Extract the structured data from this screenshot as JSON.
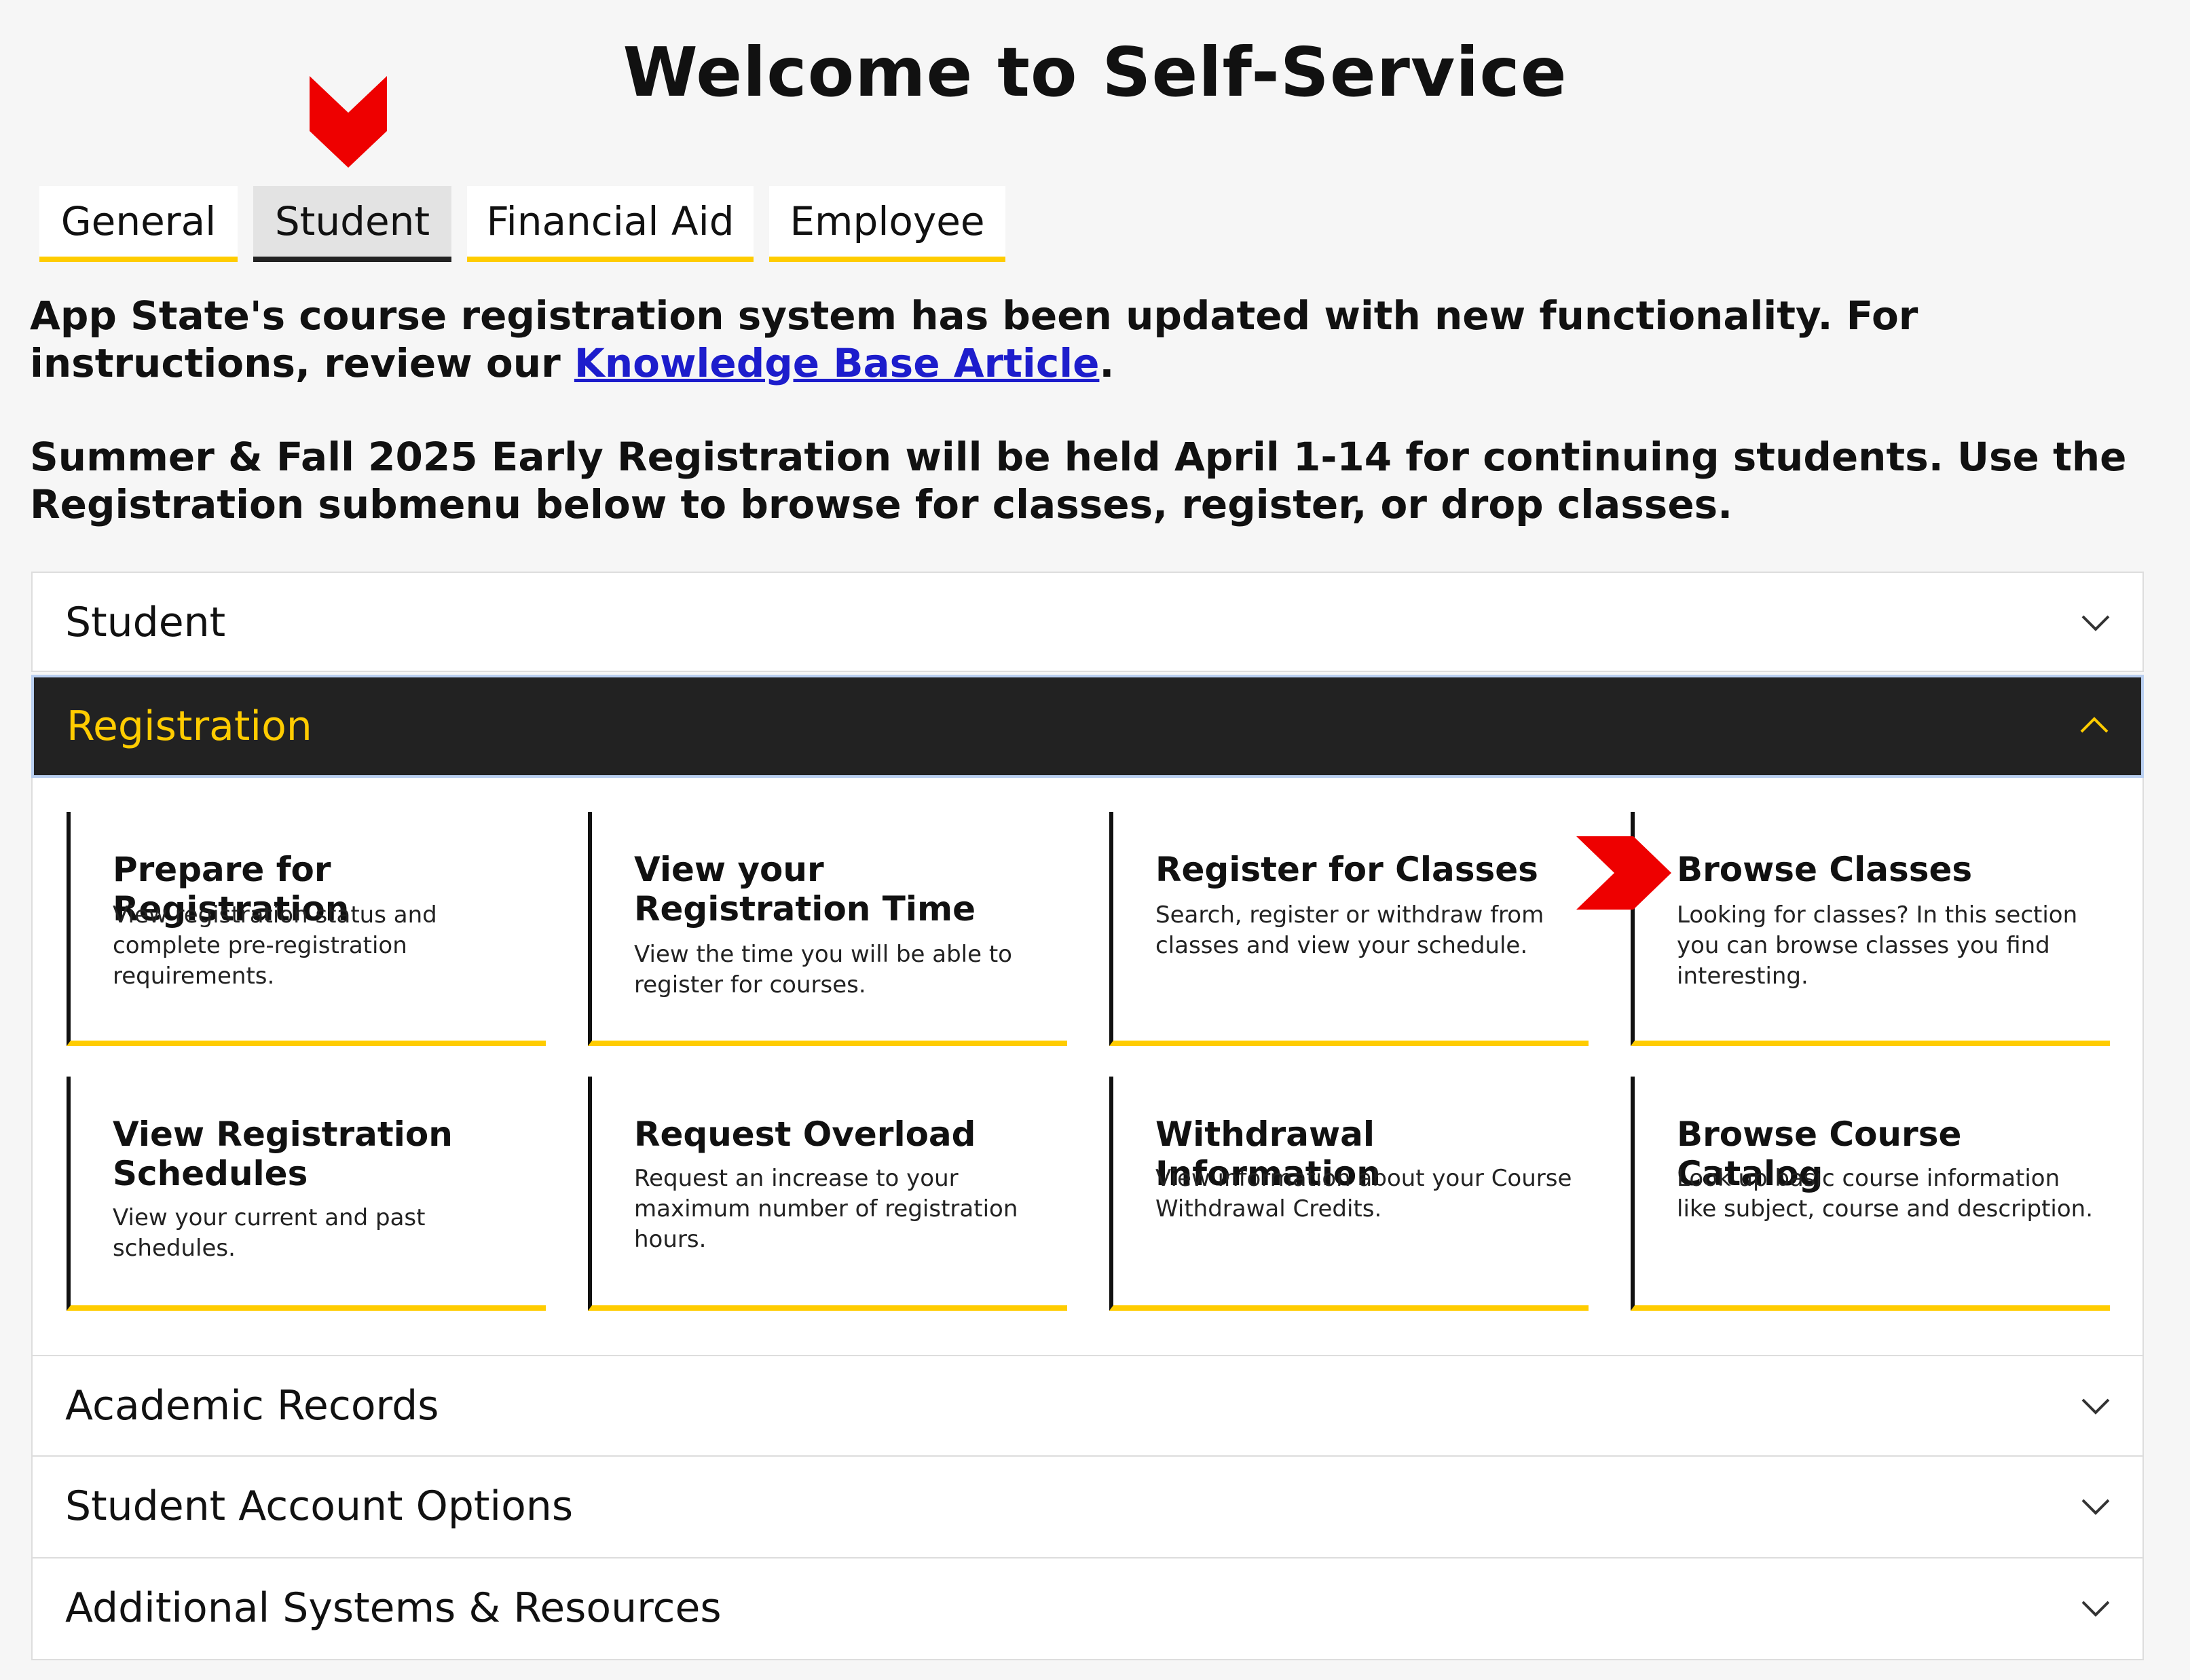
{
  "page": {
    "title": "Welcome to Self-Service"
  },
  "tabs": [
    {
      "label": "General"
    },
    {
      "label": "Student"
    },
    {
      "label": "Financial Aid"
    },
    {
      "label": "Employee"
    }
  ],
  "active_tab": "Student",
  "intro": {
    "line1_text": "App State's course registration system has been updated with new functionality. For instructions, review our",
    "link_text": "Knowledge Base Article",
    "link_suffix": ".",
    "line2_text": "Summer & Fall 2025 Early Registration will be held April 1-14 for continuing students. Use the Registration submenu below to browse for classes, register, or drop classes."
  },
  "accordion": {
    "student": {
      "label": "Student",
      "expanded": false
    },
    "registration": {
      "label": "Registration",
      "expanded": true
    },
    "academic_records": {
      "label": "Academic Records",
      "expanded": false
    },
    "student_account": {
      "label": "Student Account Options",
      "expanded": false
    },
    "additional": {
      "label": "Additional Systems & Resources",
      "expanded": false
    }
  },
  "cards": [
    {
      "title": "Prepare for Registration",
      "desc": "View registration status and complete pre-registration requirements."
    },
    {
      "title": "View your Registration Time",
      "desc": "View the time you will be able to register for courses."
    },
    {
      "title": "Register for Classes",
      "desc": "Search, register or withdraw from classes and view your schedule."
    },
    {
      "title": "Browse Classes",
      "desc": "Looking for classes? In this section you can browse classes you find interesting."
    },
    {
      "title": "View Registration Schedules",
      "desc": "View your current and past schedules."
    },
    {
      "title": "Request Overload",
      "desc": "Request an increase to your maximum number of registration hours."
    },
    {
      "title": "Withdrawal Information",
      "desc": "View information about your Course Withdrawal Credits."
    },
    {
      "title": "Browse Course Catalog",
      "desc": "Look up basic course information like subject, course and description."
    }
  ],
  "colors": {
    "accent_yellow": "#ffcc00",
    "header_dark": "#222222",
    "link_blue": "#1d1dcc",
    "annotation_red": "#ee0000"
  },
  "icons": {
    "chevron_down": "chevron-down-icon",
    "chevron_up": "chevron-up-icon",
    "annotation_arrow_down": "red-arrow-down-icon",
    "annotation_arrow_right": "red-arrow-right-icon"
  }
}
